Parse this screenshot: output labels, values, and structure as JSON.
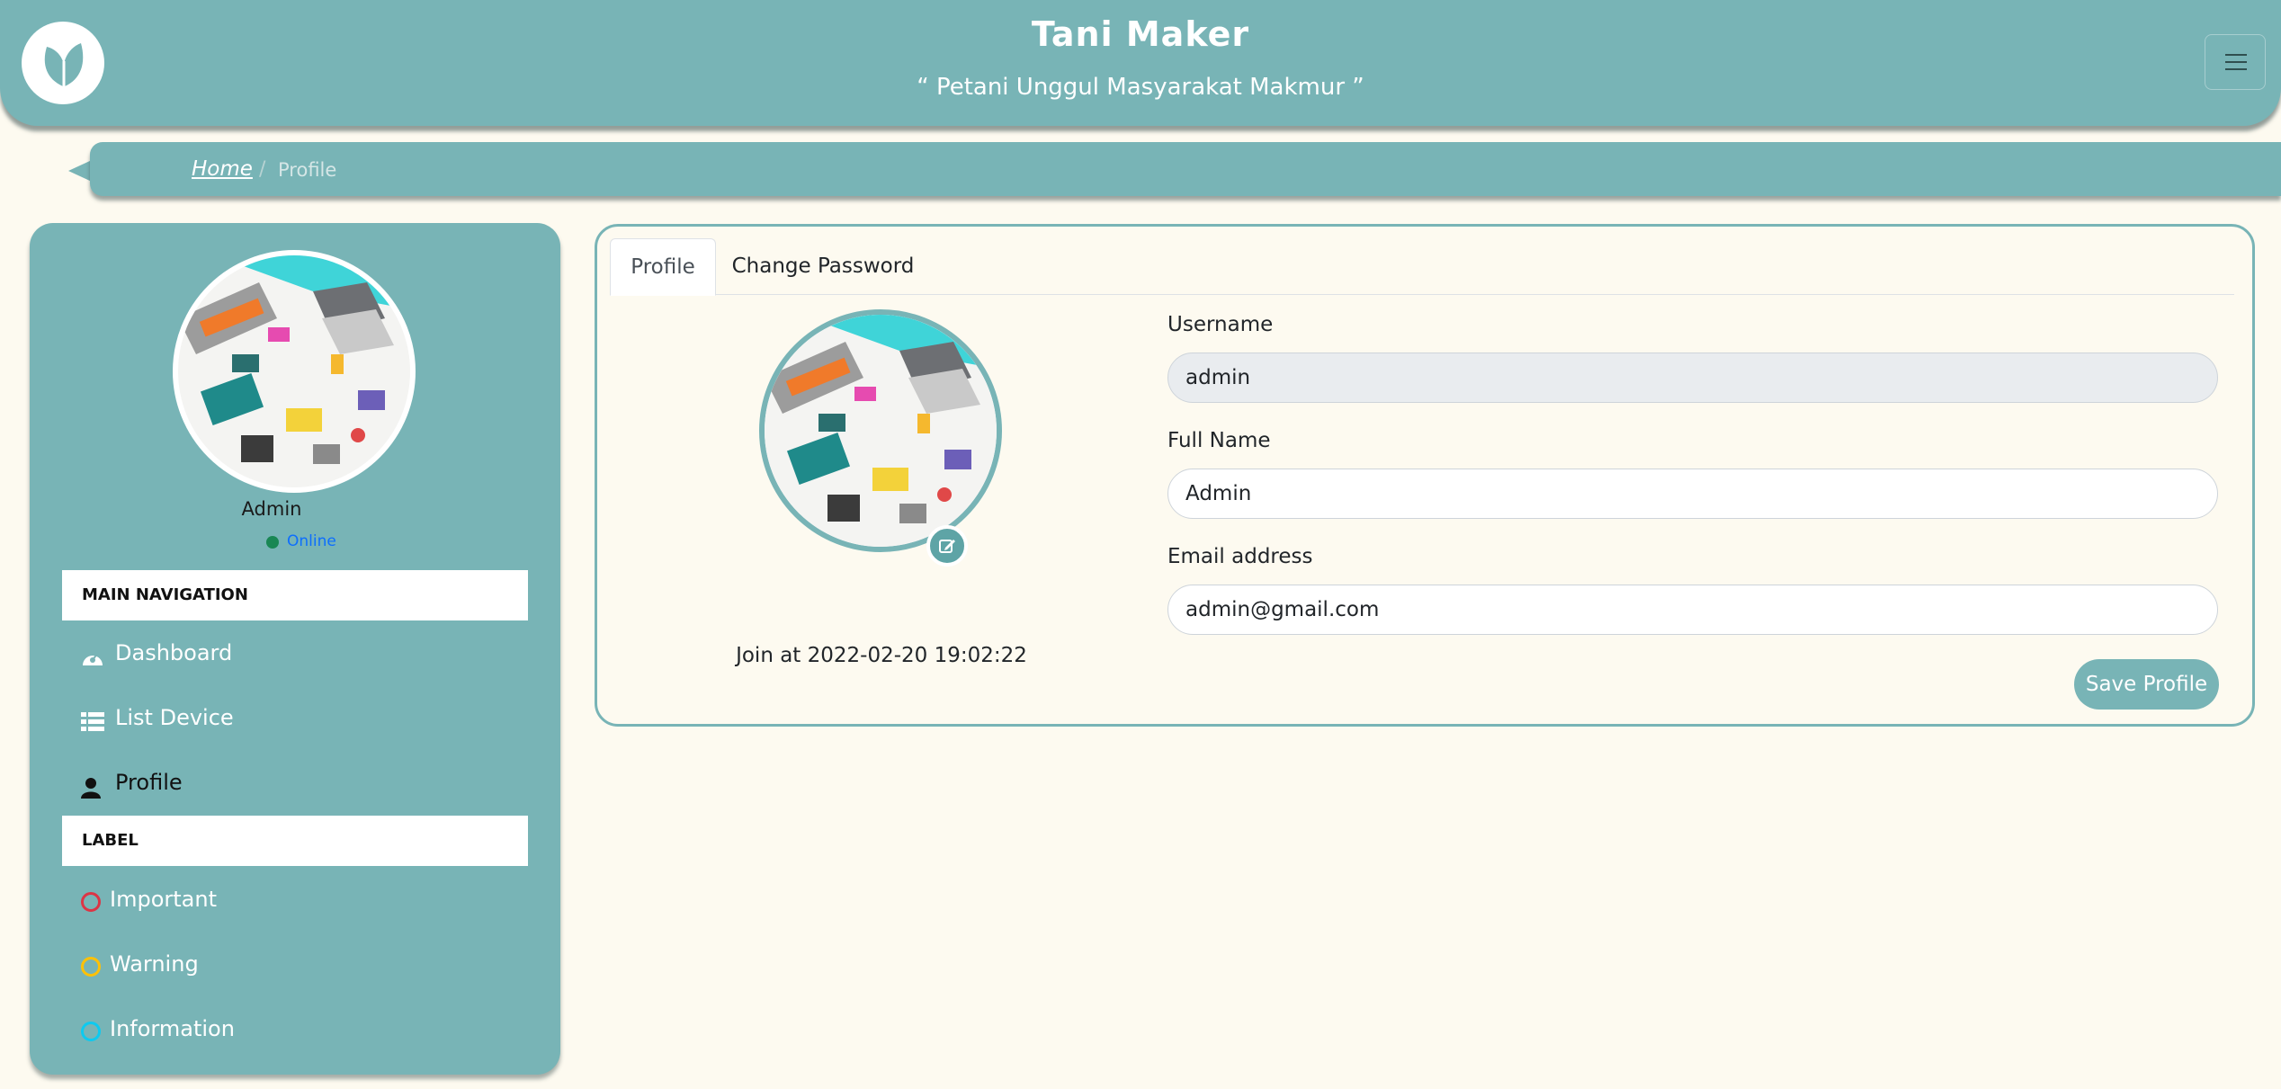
{
  "header": {
    "title": "Tani Maker",
    "subtitle": "“ Petani Unggul Masyarakat Makmur ”",
    "logo_icon": "leaf-icon",
    "menu_icon": "hamburger-icon"
  },
  "breadcrumb": {
    "home": "Home",
    "separator": "/",
    "current": "Profile"
  },
  "sidebar": {
    "user_name": "Admin",
    "status": "Online",
    "main_nav_header": "MAIN NAVIGATION",
    "nav": [
      {
        "label": "Dashboard",
        "icon": "dashboard-icon"
      },
      {
        "label": "List Device",
        "icon": "list-icon"
      },
      {
        "label": "Profile",
        "icon": "user-icon"
      }
    ],
    "label_header": "LABEL",
    "labels": [
      {
        "label": "Important",
        "color": "#dc3545"
      },
      {
        "label": "Warning",
        "color": "#ffc107"
      },
      {
        "label": "Information",
        "color": "#0dcaf0"
      }
    ]
  },
  "tabs": [
    {
      "label": "Profile"
    },
    {
      "label": "Change Password"
    }
  ],
  "profile": {
    "join_text": "Join at 2022-02-20 19:02:22",
    "username_label": "Username",
    "username_value": "admin",
    "fullname_label": "Full Name",
    "fullname_value": "Admin",
    "email_label": "Email address",
    "email_value": "admin@gmail.com",
    "save_label": "Save Profile",
    "edit_icon": "edit-icon"
  },
  "colors": {
    "accent": "#78b4b6",
    "background": "#fdfaf0"
  }
}
